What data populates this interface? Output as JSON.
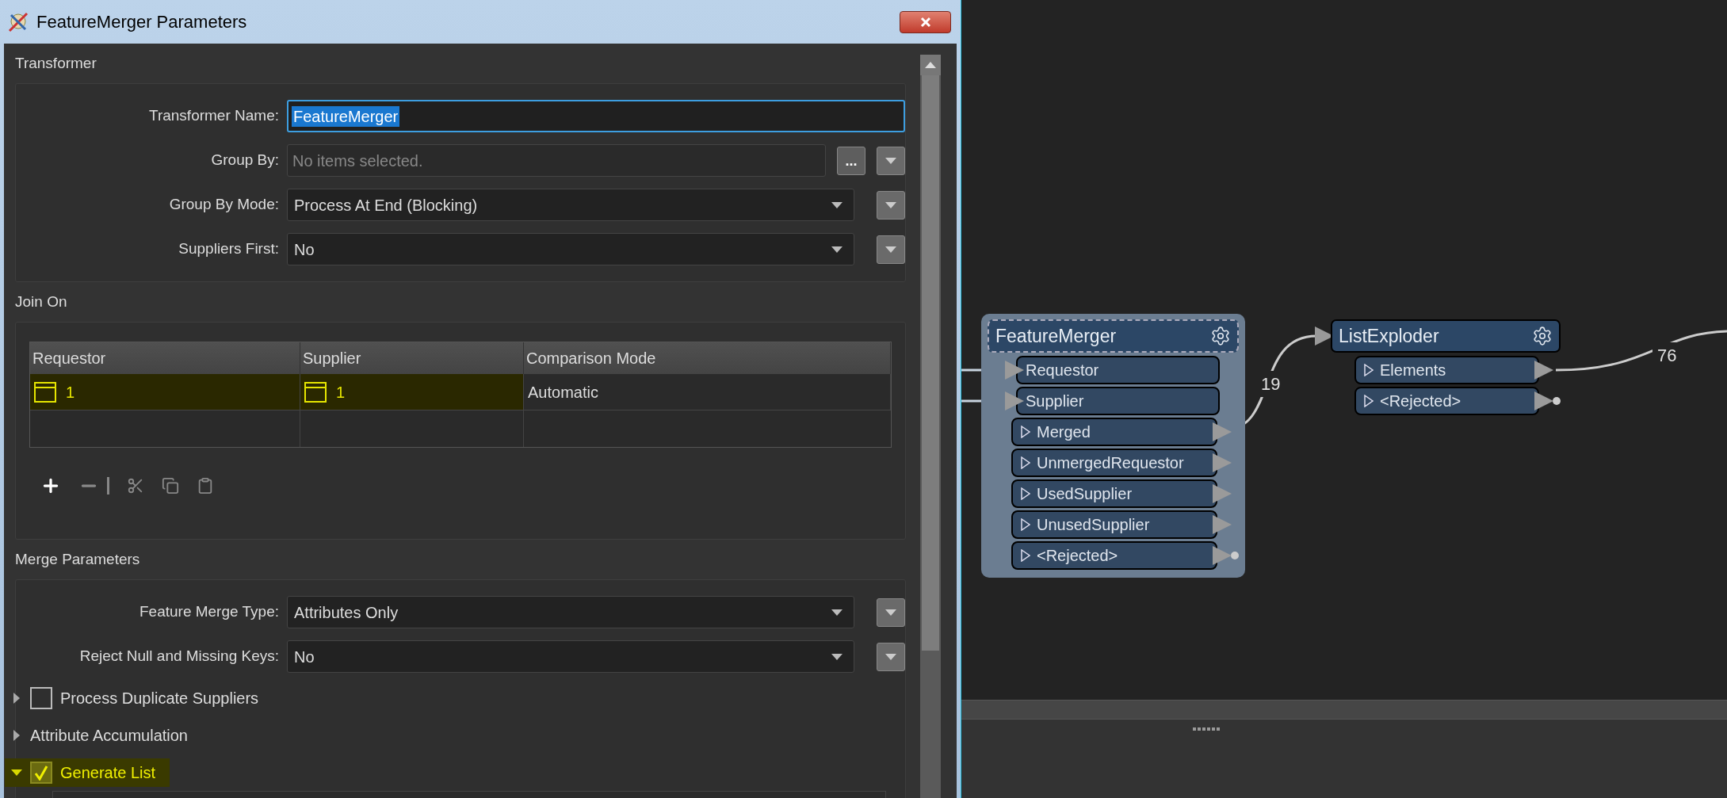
{
  "window": {
    "title": "FeatureMerger Parameters"
  },
  "sections": [
    {
      "title": "Transformer",
      "fields": [
        {
          "kind": "text",
          "label": "Transformer Name:",
          "value": "FeatureMerger",
          "focused": true
        },
        {
          "kind": "list",
          "label": "Group By:",
          "placeholder": "No items selected.",
          "button": "..."
        },
        {
          "kind": "select",
          "label": "Group By Mode:",
          "value": "Process At End (Blocking)"
        },
        {
          "kind": "select",
          "label": "Suppliers First:",
          "value": "No"
        }
      ]
    },
    {
      "title": "Join On",
      "table": {
        "columns": [
          "Requestor",
          "Supplier",
          "Comparison Mode"
        ],
        "rows": [
          {
            "cells": [
              "1",
              "1",
              "Automatic"
            ],
            "highlighted": true
          }
        ]
      }
    },
    {
      "title": "Merge Parameters",
      "fields": [
        {
          "kind": "select",
          "label": "Feature Merge Type:",
          "value": "Attributes Only"
        },
        {
          "kind": "select",
          "label": "Reject Null and Missing Keys:",
          "value": "No"
        }
      ],
      "groups": [
        {
          "kind": "checkbox",
          "label": "Process Duplicate Suppliers",
          "expanded": false,
          "checked": false,
          "highlighted": false
        },
        {
          "kind": "plain",
          "label": "Attribute Accumulation",
          "expanded": false,
          "highlighted": false
        },
        {
          "kind": "checkbox",
          "label": "Generate List",
          "expanded": true,
          "checked": true,
          "highlighted": true
        }
      ]
    }
  ],
  "canvas": {
    "nodes": [
      {
        "title": "FeatureMerger",
        "selected": true,
        "inputs": [
          "Requestor",
          "Supplier"
        ],
        "outputs": [
          "Merged",
          "UnmergedRequestor",
          "UsedSupplier",
          "UnusedSupplier",
          "<Rejected>"
        ]
      },
      {
        "title": "ListExploder",
        "selected": false,
        "outputs": [
          "Elements",
          "<Rejected>"
        ]
      }
    ],
    "connections": [
      {
        "label": "19"
      },
      {
        "label": "76"
      }
    ]
  }
}
